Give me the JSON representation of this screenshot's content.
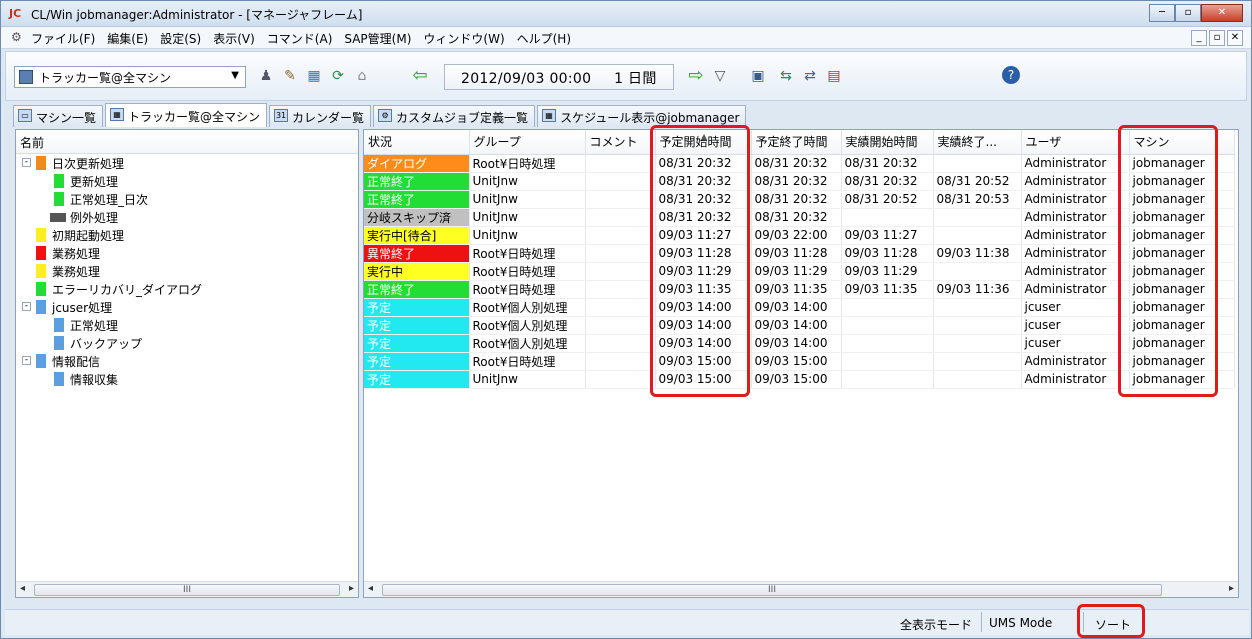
{
  "window": {
    "title": "CL/Win jobmanager:Administrator - [マネージャフレーム]",
    "app_icon": "JC"
  },
  "menu": [
    "ファイル(F)",
    "編集(E)",
    "設定(S)",
    "表示(V)",
    "コマンド(A)",
    "SAP管理(M)",
    "ウィンドウ(W)",
    "ヘルプ(H)"
  ],
  "toolbar": {
    "tracker_select": "トラッカー覧@全マシン",
    "date": "2012/09/03 00:00",
    "span": "1 日間"
  },
  "tabs": [
    "マシン一覧",
    "トラッカー覧@全マシン",
    "カレンダー覧",
    "カスタムジョブ定義一覧",
    "スケジュール表示@jobmanager"
  ],
  "tree": {
    "header": "名前",
    "items": [
      "日次更新処理",
      "更新処理",
      "正常処理_日次",
      "例外処理",
      "初期起動処理",
      "業務処理",
      "業務処理",
      "エラーリカバリ_ダイアログ",
      "jcuser処理",
      "正常処理",
      "バックアップ",
      "情報配信",
      "情報収集"
    ]
  },
  "grid": {
    "columns": [
      "状況",
      "グループ",
      "コメント",
      "予定開始時間",
      "予定終了時間",
      "実績開始時間",
      "実績終了...",
      "ユーザ",
      "マシン"
    ],
    "rows": [
      {
        "status": "ダイアログ",
        "color": "#ff8c1a",
        "group": "Root¥日時処理",
        "comment": "",
        "sched_start": "08/31 20:32",
        "sched_end": "08/31 20:32",
        "act_start": "08/31 20:32",
        "act_end": "",
        "user": "Administrator",
        "machine": "jobmanager"
      },
      {
        "status": "正常終了",
        "color": "#22dd33",
        "group": "UnitJnw",
        "comment": "",
        "sched_start": "08/31 20:32",
        "sched_end": "08/31 20:32",
        "act_start": "08/31 20:32",
        "act_end": "08/31 20:52",
        "user": "Administrator",
        "machine": "jobmanager"
      },
      {
        "status": "正常終了",
        "color": "#22dd33",
        "group": "UnitJnw",
        "comment": "",
        "sched_start": "08/31 20:32",
        "sched_end": "08/31 20:32",
        "act_start": "08/31 20:52",
        "act_end": "08/31 20:53",
        "user": "Administrator",
        "machine": "jobmanager"
      },
      {
        "status": "分岐スキップ済",
        "color": "#c0c0c0",
        "group": "UnitJnw",
        "comment": "",
        "sched_start": "08/31 20:32",
        "sched_end": "08/31 20:32",
        "act_start": "",
        "act_end": "",
        "user": "Administrator",
        "machine": "jobmanager"
      },
      {
        "status": "実行中[待合]",
        "color": "#ffff22",
        "group": "UnitJnw",
        "comment": "",
        "sched_start": "09/03 11:27",
        "sched_end": "09/03 22:00",
        "act_start": "09/03 11:27",
        "act_end": "",
        "user": "Administrator",
        "machine": "jobmanager"
      },
      {
        "status": "異常終了",
        "color": "#ee1111",
        "group": "Root¥日時処理",
        "comment": "",
        "sched_start": "09/03 11:28",
        "sched_end": "09/03 11:28",
        "act_start": "09/03 11:28",
        "act_end": "09/03 11:38",
        "user": "Administrator",
        "machine": "jobmanager"
      },
      {
        "status": "実行中",
        "color": "#ffff22",
        "group": "Root¥日時処理",
        "comment": "",
        "sched_start": "09/03 11:29",
        "sched_end": "09/03 11:29",
        "act_start": "09/03 11:29",
        "act_end": "",
        "user": "Administrator",
        "machine": "jobmanager"
      },
      {
        "status": "正常終了",
        "color": "#22dd33",
        "group": "Root¥日時処理",
        "comment": "",
        "sched_start": "09/03 11:35",
        "sched_end": "09/03 11:35",
        "act_start": "09/03 11:35",
        "act_end": "09/03 11:36",
        "user": "Administrator",
        "machine": "jobmanager"
      },
      {
        "status": "予定",
        "color": "#22e8f0",
        "group": "Root¥個人別処理",
        "comment": "",
        "sched_start": "09/03 14:00",
        "sched_end": "09/03 14:00",
        "act_start": "",
        "act_end": "",
        "user": "jcuser",
        "machine": "jobmanager"
      },
      {
        "status": "予定",
        "color": "#22e8f0",
        "group": "Root¥個人別処理",
        "comment": "",
        "sched_start": "09/03 14:00",
        "sched_end": "09/03 14:00",
        "act_start": "",
        "act_end": "",
        "user": "jcuser",
        "machine": "jobmanager"
      },
      {
        "status": "予定",
        "color": "#22e8f0",
        "group": "Root¥個人別処理",
        "comment": "",
        "sched_start": "09/03 14:00",
        "sched_end": "09/03 14:00",
        "act_start": "",
        "act_end": "",
        "user": "jcuser",
        "machine": "jobmanager"
      },
      {
        "status": "予定",
        "color": "#22e8f0",
        "group": "Root¥日時処理",
        "comment": "",
        "sched_start": "09/03 15:00",
        "sched_end": "09/03 15:00",
        "act_start": "",
        "act_end": "",
        "user": "Administrator",
        "machine": "jobmanager"
      },
      {
        "status": "予定",
        "color": "#22e8f0",
        "group": "UnitJnw",
        "comment": "",
        "sched_start": "09/03 15:00",
        "sched_end": "09/03 15:00",
        "act_start": "",
        "act_end": "",
        "user": "Administrator",
        "machine": "jobmanager"
      }
    ]
  },
  "statusbar": {
    "mode": "全表示モード",
    "ums": "UMS Mode",
    "sort": "ソート"
  }
}
